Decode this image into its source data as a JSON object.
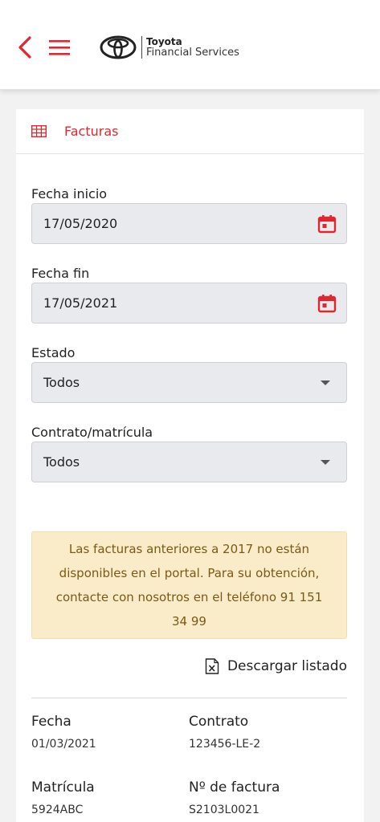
{
  "header": {
    "brand_line1": "Toyota",
    "brand_line2": "Financial Services",
    "back_icon": "chevron-left-icon",
    "menu_icon": "hamburger-icon"
  },
  "colors": {
    "accent": "#e0262e",
    "notice_bg": "#faebc9",
    "notice_text": "#7a5a14"
  },
  "section": {
    "title": "Facturas",
    "icon": "table-icon"
  },
  "form": {
    "fecha_inicio": {
      "label": "Fecha inicio",
      "value": "17/05/2020"
    },
    "fecha_fin": {
      "label": "Fecha fin",
      "value": "17/05/2021"
    },
    "estado": {
      "label": "Estado",
      "value": "Todos"
    },
    "contrato": {
      "label": "Contrato/matrícula",
      "value": "Todos"
    }
  },
  "notice": {
    "text": "Las facturas anteriores a 2017 no están disponibles en el portal. Para su obtención, contacte con nosotros en el teléfono 91 151 34 99"
  },
  "download": {
    "label": "Descargar listado",
    "icon": "excel-file-icon"
  },
  "invoice": {
    "fecha_label": "Fecha",
    "fecha_value": "01/03/2021",
    "contrato_label": "Contrato",
    "contrato_value": "123456-LE-2",
    "matricula_label": "Matrícula",
    "matricula_value": "5924ABC",
    "factura_label": "Nº de factura",
    "factura_value": "S2103L0021"
  }
}
